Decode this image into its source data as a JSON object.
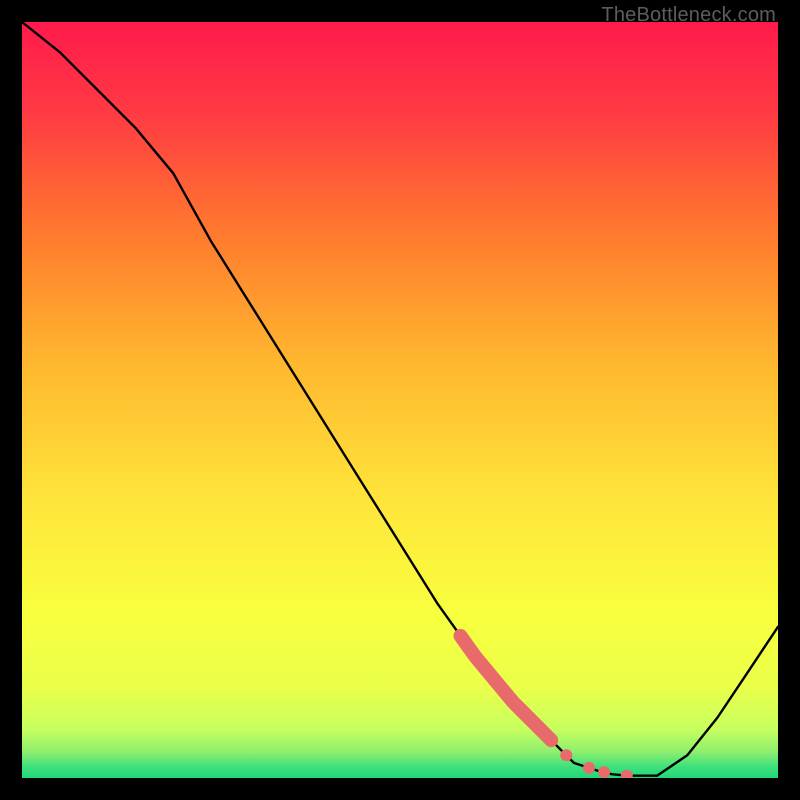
{
  "watermark": "TheBottleneck.com",
  "colors": {
    "top": "#ff1a4b",
    "mid_upper": "#ff8a2a",
    "mid": "#ffe23a",
    "mid_lower": "#f4ff3e",
    "lower_band": "#d8ff5a",
    "green": "#1fe07a",
    "marker": "#e96a6a",
    "curve": "#000000",
    "frame": "#000000"
  },
  "chart_data": {
    "type": "line",
    "title": "",
    "xlabel": "",
    "ylabel": "",
    "xlim": [
      0,
      100
    ],
    "ylim": [
      0,
      100
    ],
    "x": [
      0,
      5,
      10,
      15,
      20,
      25,
      30,
      35,
      40,
      45,
      50,
      55,
      60,
      65,
      70,
      73,
      76,
      78,
      80,
      84,
      88,
      92,
      96,
      100
    ],
    "y": [
      100,
      96,
      91,
      86,
      80,
      71,
      63,
      55,
      47,
      39,
      31,
      23,
      16,
      10,
      5,
      2,
      1,
      0.5,
      0.3,
      0.3,
      3,
      8,
      14,
      20
    ],
    "highlight_segment": {
      "x_from": 58,
      "x_to": 70
    },
    "highlight_dots_x": [
      72,
      75,
      77,
      80
    ]
  }
}
